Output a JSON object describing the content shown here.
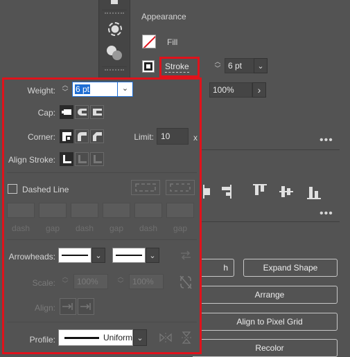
{
  "appearance": {
    "title": "Appearance",
    "fill_label": "Fill",
    "stroke_label": "Stroke",
    "stroke_weight": "6 pt",
    "opacity": "100%"
  },
  "quick_actions": {
    "expand_shape": "Expand Shape",
    "partial_button": "h",
    "arrange": "Arrange",
    "align_pixel_grid": "Align to Pixel Grid",
    "recolor": "Recolor"
  },
  "stroke_panel": {
    "weight_label": "Weight:",
    "weight_value": "6 pt",
    "cap_label": "Cap:",
    "corner_label": "Corner:",
    "limit_label": "Limit:",
    "limit_value": "10",
    "limit_unit": "x",
    "align_label": "Align Stroke:",
    "dashed_label": "Dashed Line",
    "dash_labels": [
      "dash",
      "gap",
      "dash",
      "gap",
      "dash",
      "gap"
    ],
    "arrowheads_label": "Arrowheads:",
    "scale_label": "Scale:",
    "scale_start": "100%",
    "scale_end": "100%",
    "align_arrow_label": "Align:",
    "profile_label": "Profile:",
    "profile_value": "Uniform"
  },
  "colors": {
    "highlight_border": "#e0121b",
    "panel_bg": "#535353",
    "selected_field": "#1f6ed4"
  }
}
